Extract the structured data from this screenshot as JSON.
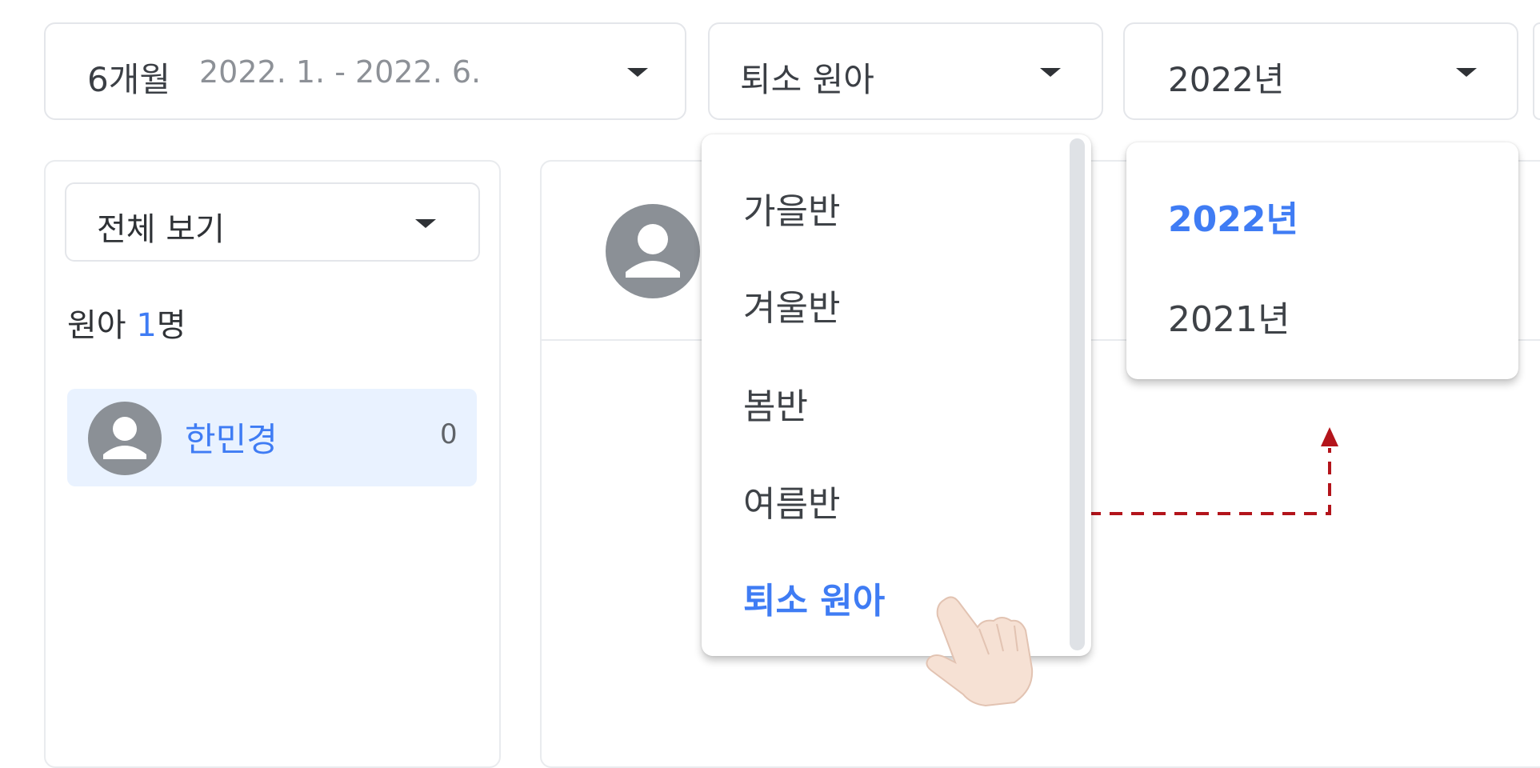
{
  "filters": {
    "period": {
      "label": "6개월",
      "range": "2022. 1. - 2022. 6."
    },
    "class": {
      "value": "퇴소 원아"
    },
    "year": {
      "value": "2022년"
    }
  },
  "sidebar": {
    "view_select": "전체 보기",
    "count_prefix": "원아 ",
    "count_value": "1",
    "count_suffix": "명",
    "children": [
      {
        "name": "한민경",
        "count": "0"
      }
    ]
  },
  "class_menu": {
    "items": [
      {
        "label": "가을반",
        "selected": false
      },
      {
        "label": "겨울반",
        "selected": false
      },
      {
        "label": "봄반",
        "selected": false
      },
      {
        "label": "여름반",
        "selected": false
      },
      {
        "label": "퇴소 원아",
        "selected": true
      }
    ]
  },
  "year_menu": {
    "items": [
      {
        "label": "2022년",
        "selected": true
      },
      {
        "label": "2021년",
        "selected": false
      }
    ]
  },
  "colors": {
    "accent": "#3f7cf4",
    "selected_bg": "#e9f2ff",
    "annotation": "#b3141b",
    "avatar": "#8b9096"
  },
  "icons": [
    "caret-down-icon",
    "avatar-icon",
    "pointing-hand-icon",
    "arrow-up-icon"
  ]
}
